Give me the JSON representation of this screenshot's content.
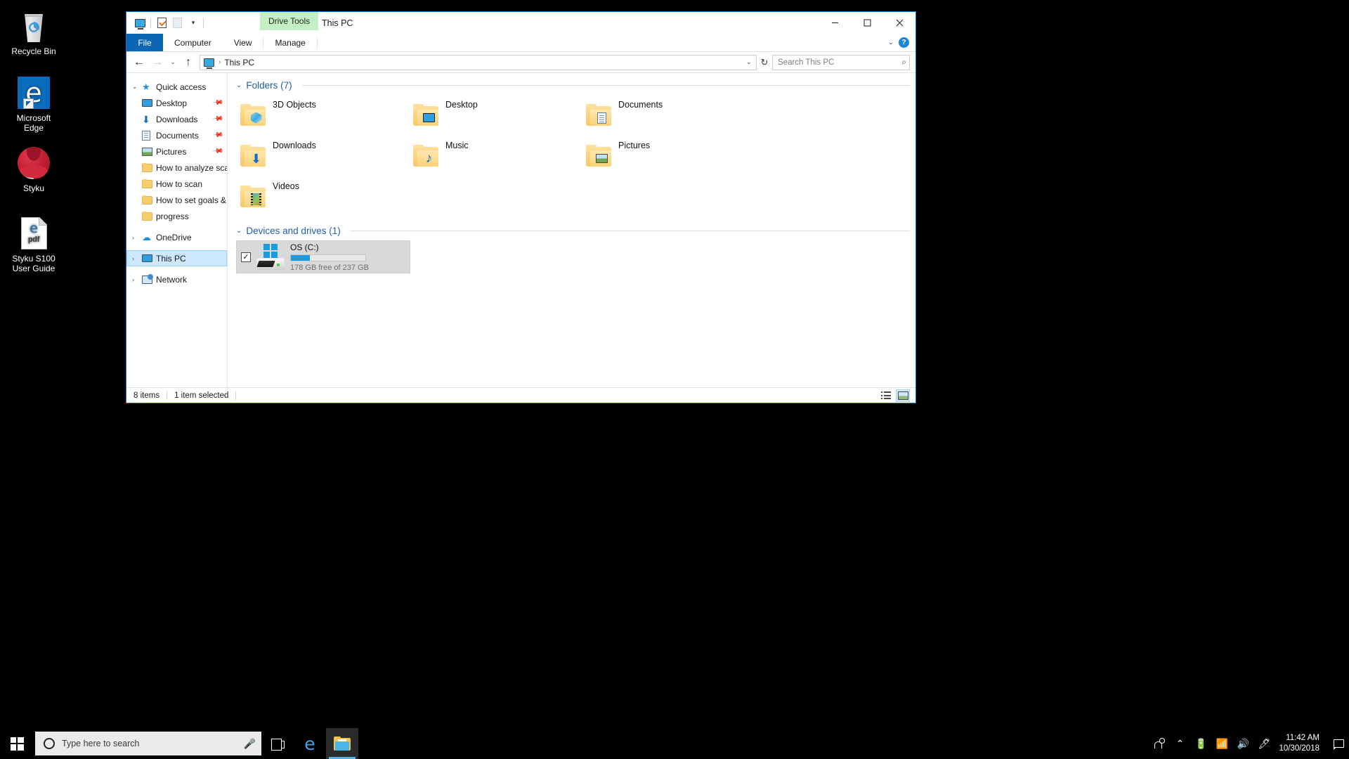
{
  "desktop": {
    "icons": [
      {
        "label": "Recycle Bin",
        "icon": "recycle-bin-icon",
        "shortcut": false
      },
      {
        "label": "Microsoft\nEdge",
        "label_line1": "Microsoft",
        "label_line2": "Edge",
        "icon": "edge-icon",
        "shortcut": true
      },
      {
        "label": "Styku",
        "icon": "styku-icon",
        "shortcut": true
      },
      {
        "label_line1": "Styku S100",
        "label_line2": "User Guide",
        "icon": "pdf-document-icon",
        "shortcut": false
      }
    ]
  },
  "explorer": {
    "title": "This PC",
    "contextual_tab_group": "Drive Tools",
    "quick_access_toolbar": [
      {
        "name": "this-pc-icon"
      },
      {
        "name": "properties-icon"
      },
      {
        "name": "new-folder-icon"
      },
      {
        "name": "customize-caret-icon"
      }
    ],
    "window_controls": {
      "minimize": "minimize-button",
      "maximize": "maximize-button",
      "close": "close-button"
    },
    "ribbon": {
      "tabs": [
        {
          "label": "File",
          "active_file": true
        },
        {
          "label": "Computer",
          "active_file": false
        },
        {
          "label": "View",
          "active_file": false
        },
        {
          "label": "Manage",
          "active_file": false
        }
      ],
      "minimize_ribbon": "collapse-ribbon-icon",
      "help": "?"
    },
    "address_bar": {
      "back": "back-arrow-icon",
      "forward": "forward-arrow-icon",
      "recent": "recent-locations-caret-icon",
      "up": "up-arrow-icon",
      "crumbs": [
        "This PC"
      ],
      "separator": "›",
      "dropdown": "address-dropdown-caret",
      "refresh": "↻"
    },
    "search": {
      "placeholder": "Search This PC",
      "icon": "search-icon"
    },
    "navigation_pane": [
      {
        "label": "Quick access",
        "icon": "star-icon",
        "indent": 0,
        "expander": "open",
        "pinned": false,
        "selected": false
      },
      {
        "label": "Desktop",
        "icon": "desktop-icon",
        "indent": 1,
        "expander": "none",
        "pinned": true,
        "selected": false
      },
      {
        "label": "Downloads",
        "icon": "downloads-icon",
        "indent": 1,
        "expander": "none",
        "pinned": true,
        "selected": false
      },
      {
        "label": "Documents",
        "icon": "documents-icon",
        "indent": 1,
        "expander": "none",
        "pinned": true,
        "selected": false
      },
      {
        "label": "Pictures",
        "icon": "pictures-icon",
        "indent": 1,
        "expander": "none",
        "pinned": true,
        "selected": false
      },
      {
        "label": "How to analyze scan",
        "icon": "folder-icon",
        "indent": 1,
        "expander": "none",
        "pinned": false,
        "selected": false
      },
      {
        "label": "How to scan",
        "icon": "folder-icon",
        "indent": 1,
        "expander": "none",
        "pinned": false,
        "selected": false
      },
      {
        "label": "How to set goals &",
        "icon": "folder-icon",
        "indent": 1,
        "expander": "none",
        "pinned": false,
        "selected": false
      },
      {
        "label": "progress",
        "icon": "folder-icon",
        "indent": 1,
        "expander": "none",
        "pinned": false,
        "selected": false
      },
      {
        "label": "OneDrive",
        "icon": "onedrive-icon",
        "indent": 0,
        "expander": "closed",
        "pinned": false,
        "selected": false
      },
      {
        "label": "This PC",
        "icon": "this-pc-icon",
        "indent": 0,
        "expander": "closed",
        "pinned": false,
        "selected": true
      },
      {
        "label": "Network",
        "icon": "network-icon",
        "indent": 0,
        "expander": "closed",
        "pinned": false,
        "selected": false
      }
    ],
    "groups": [
      {
        "title": "Folders (7)",
        "items": [
          {
            "name": "3D Objects",
            "emblem": "cube-emblem"
          },
          {
            "name": "Desktop",
            "emblem": "monitor-emblem"
          },
          {
            "name": "Documents",
            "emblem": "document-emblem"
          },
          {
            "name": "Downloads",
            "emblem": "down-arrow-emblem"
          },
          {
            "name": "Music",
            "emblem": "music-note-emblem"
          },
          {
            "name": "Pictures",
            "emblem": "picture-emblem"
          },
          {
            "name": "Videos",
            "emblem": "film-emblem"
          }
        ]
      },
      {
        "title": "Devices and drives (1)",
        "drives": [
          {
            "name": "OS (C:)",
            "free_text": "178 GB free of 237 GB",
            "free_gb": 178,
            "total_gb": 237,
            "used_percent": 25,
            "checked": true,
            "selected": true,
            "bar_color": "#1b9ae0"
          }
        ]
      }
    ],
    "status_bar": {
      "item_count": "8 items",
      "selection": "1 item selected",
      "views": [
        {
          "name": "details-view-button",
          "active": false
        },
        {
          "name": "large-icons-view-button",
          "active": true
        }
      ]
    }
  },
  "taskbar": {
    "start": "windows-start-icon",
    "search_placeholder": "Type here to search",
    "cortana_icon": "cortana-circle-icon",
    "mic_icon": "microphone-icon",
    "task_view": "task-view-icon",
    "pinned": [
      {
        "name": "edge-taskbar-icon",
        "active": false
      },
      {
        "name": "file-explorer-taskbar-icon",
        "active": true
      }
    ],
    "tray": [
      {
        "name": "people-icon"
      },
      {
        "name": "show-hidden-icons-chevron"
      },
      {
        "name": "battery-icon"
      },
      {
        "name": "wifi-icon"
      },
      {
        "name": "volume-icon"
      },
      {
        "name": "pen-workspace-icon"
      }
    ],
    "clock": {
      "time": "11:42 AM",
      "date": "10/30/2018"
    },
    "action_center": "action-center-icon"
  }
}
